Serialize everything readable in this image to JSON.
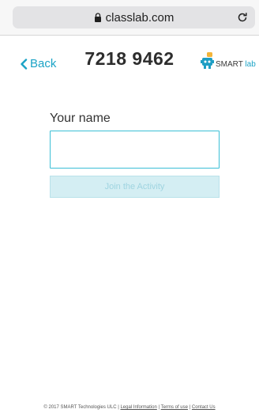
{
  "browser": {
    "url": "classlab.com",
    "lock_icon": "lock-icon",
    "reload_icon": "reload-icon"
  },
  "header": {
    "back_label": "Back",
    "session_code": "7218 9462",
    "logo": {
      "brand": "SMART",
      "product": "lab",
      "icon": "smart-lab-robot-icon"
    },
    "accent_color": "#1ba3c6"
  },
  "form": {
    "name_label": "Your name",
    "name_value": "",
    "join_label": "Join the Activity"
  },
  "footer": {
    "copyright": "© 2017 SMART Technologies ULC | ",
    "legal": "Legal Information",
    "sep1": " | ",
    "terms": "Terms of use",
    "sep2": " | ",
    "contact": "Contact Us"
  }
}
